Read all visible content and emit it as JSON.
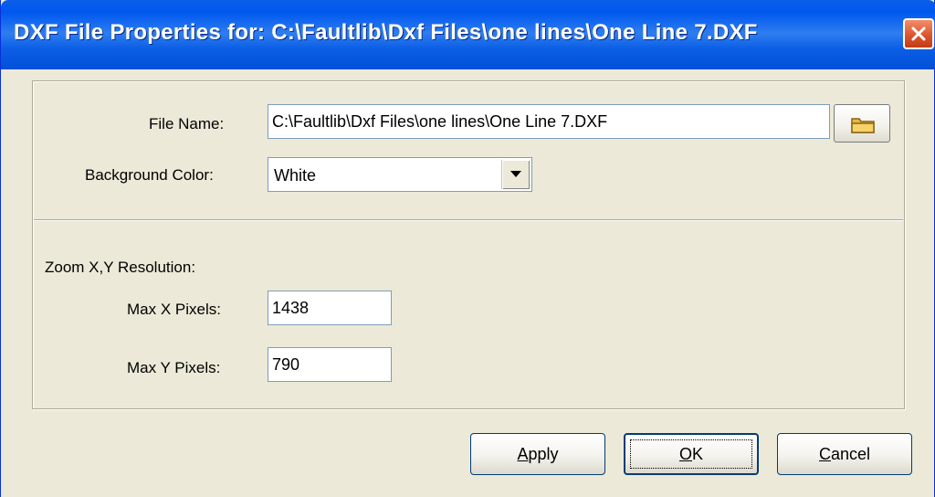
{
  "window": {
    "title": "DXF File Properties for: C:\\Faultlib\\Dxf Files\\one lines\\One Line 7.DXF"
  },
  "form": {
    "file_name_label": "File Name:",
    "file_name_value": "C:\\Faultlib\\Dxf Files\\one lines\\One Line 7.DXF",
    "background_color_label": "Background Color:",
    "background_color_value": "White",
    "zoom_heading": "Zoom X,Y Resolution:",
    "max_x_label": "Max X Pixels:",
    "max_x_value": "1438",
    "max_y_label": "Max Y Pixels:",
    "max_y_value": "790"
  },
  "buttons": {
    "apply": {
      "underline": "A",
      "rest": "pply"
    },
    "ok": {
      "underline": "O",
      "rest": "K"
    },
    "cancel": {
      "underline": "C",
      "rest": "ancel"
    }
  },
  "icons": {
    "close": "close-icon",
    "folder": "folder-icon",
    "dropdown": "chevron-down-icon"
  },
  "colors": {
    "titlebar": "#0058ee",
    "dialog_bg": "#ece9d8",
    "close_button": "#d8522a"
  }
}
